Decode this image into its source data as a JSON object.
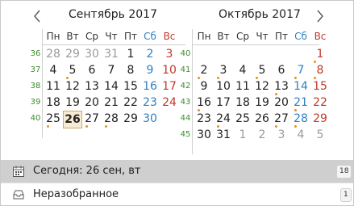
{
  "nav": {
    "prev_icon": "chevron-left-icon",
    "next_icon": "chevron-right-icon"
  },
  "weekday_labels": [
    "Пн",
    "Вт",
    "Ср",
    "Чт",
    "Пт",
    "Сб",
    "Вс"
  ],
  "months": [
    {
      "title": "Сентябрь 2017",
      "weeks": [
        {
          "number": "36",
          "days": [
            {
              "d": "28",
              "other": true
            },
            {
              "d": "29",
              "other": true
            },
            {
              "d": "30",
              "other": true
            },
            {
              "d": "31",
              "other": true
            },
            {
              "d": "1"
            },
            {
              "d": "2"
            },
            {
              "d": "3"
            }
          ]
        },
        {
          "number": "37",
          "days": [
            {
              "d": "4"
            },
            {
              "d": "5",
              "dot": true
            },
            {
              "d": "6"
            },
            {
              "d": "7"
            },
            {
              "d": "8"
            },
            {
              "d": "9"
            },
            {
              "d": "10"
            }
          ]
        },
        {
          "number": "38",
          "days": [
            {
              "d": "11"
            },
            {
              "d": "12"
            },
            {
              "d": "13"
            },
            {
              "d": "14"
            },
            {
              "d": "15"
            },
            {
              "d": "16"
            },
            {
              "d": "17"
            }
          ]
        },
        {
          "number": "39",
          "days": [
            {
              "d": "18"
            },
            {
              "d": "19"
            },
            {
              "d": "20"
            },
            {
              "d": "21"
            },
            {
              "d": "22"
            },
            {
              "d": "23"
            },
            {
              "d": "24"
            }
          ]
        },
        {
          "number": "40",
          "days": [
            {
              "d": "25",
              "dot": true
            },
            {
              "d": "26",
              "today": true
            },
            {
              "d": "27",
              "dot": true
            },
            {
              "d": "28",
              "dot": true
            },
            {
              "d": "29"
            },
            {
              "d": "30"
            },
            {
              "d": ""
            }
          ]
        }
      ]
    },
    {
      "title": "Октябрь 2017",
      "weeks": [
        {
          "number": "40",
          "days": [
            {
              "d": ""
            },
            {
              "d": ""
            },
            {
              "d": ""
            },
            {
              "d": ""
            },
            {
              "d": ""
            },
            {
              "d": ""
            },
            {
              "d": "1",
              "dot": true
            }
          ]
        },
        {
          "number": "41",
          "days": [
            {
              "d": "2",
              "dot": true
            },
            {
              "d": "3",
              "dot": true
            },
            {
              "d": "4"
            },
            {
              "d": "5",
              "dot": true
            },
            {
              "d": "6"
            },
            {
              "d": "7",
              "dot": true
            },
            {
              "d": "8",
              "dot": true
            }
          ]
        },
        {
          "number": "42",
          "days": [
            {
              "d": "9"
            },
            {
              "d": "10"
            },
            {
              "d": "11"
            },
            {
              "d": "12"
            },
            {
              "d": "13",
              "dot": true
            },
            {
              "d": "14"
            },
            {
              "d": "15"
            }
          ]
        },
        {
          "number": "43",
          "days": [
            {
              "d": "16",
              "dot": true
            },
            {
              "d": "17"
            },
            {
              "d": "18"
            },
            {
              "d": "19"
            },
            {
              "d": "20"
            },
            {
              "d": "21",
              "dot": true
            },
            {
              "d": "22"
            }
          ]
        },
        {
          "number": "44",
          "days": [
            {
              "d": "23"
            },
            {
              "d": "24",
              "dot": true
            },
            {
              "d": "25"
            },
            {
              "d": "26"
            },
            {
              "d": "27",
              "dot": true
            },
            {
              "d": "28",
              "dot": true
            },
            {
              "d": "29"
            }
          ]
        },
        {
          "number": "45",
          "days": [
            {
              "d": "30"
            },
            {
              "d": "31"
            },
            {
              "d": "1",
              "other": true
            },
            {
              "d": "2",
              "other": true
            },
            {
              "d": "3",
              "other": true
            },
            {
              "d": "4",
              "other": true
            },
            {
              "d": "5",
              "other": true
            }
          ]
        }
      ]
    }
  ],
  "today_bar": {
    "label": "Сегодня: 26 сен, вт",
    "count": "18",
    "icon": "calendar-icon"
  },
  "inbox_bar": {
    "label": "Неразобранное",
    "count": "1",
    "icon": "inbox-tray-icon"
  },
  "colors": {
    "saturday": "#2f7fc0",
    "sunday": "#c0392b",
    "week_number": "#3c8c2c",
    "event_dot": "#e39322",
    "today_fill": "#f7ecd3"
  }
}
